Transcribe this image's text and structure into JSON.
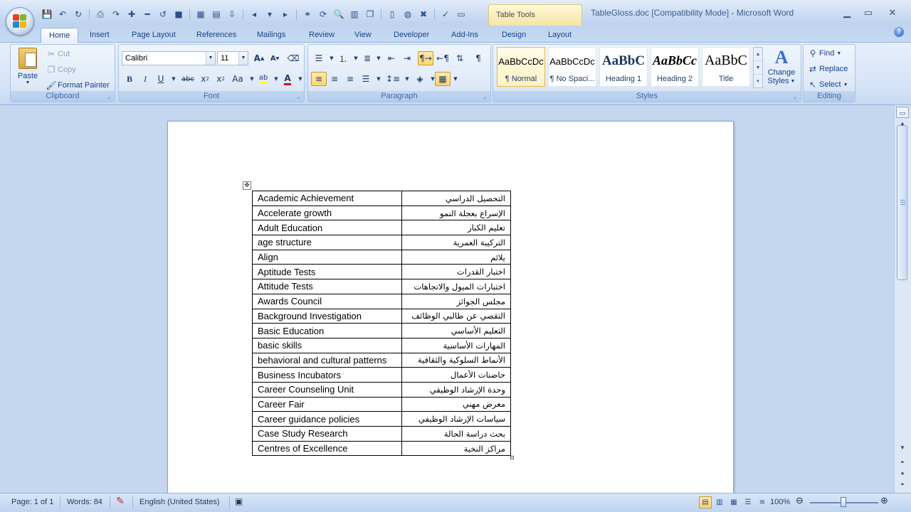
{
  "window": {
    "title": "TableGloss.doc [Compatibility Mode] - Microsoft Word",
    "contextual_tab_group": "Table Tools"
  },
  "tabs": [
    {
      "label": "Home",
      "active": true
    },
    {
      "label": "Insert"
    },
    {
      "label": "Page Layout"
    },
    {
      "label": "References"
    },
    {
      "label": "Mailings"
    },
    {
      "label": "Review"
    },
    {
      "label": "View"
    },
    {
      "label": "Developer"
    },
    {
      "label": "Add-Ins"
    },
    {
      "label": "Design"
    },
    {
      "label": "Layout"
    }
  ],
  "ribbon": {
    "clipboard": {
      "label": "Clipboard",
      "paste": "Paste",
      "cut": "Cut",
      "copy": "Copy",
      "format_painter": "Format Painter"
    },
    "font": {
      "label": "Font",
      "font_name": "Calibri",
      "font_size": "11"
    },
    "paragraph": {
      "label": "Paragraph"
    },
    "styles": {
      "label": "Styles",
      "items": [
        {
          "sample": "AaBbCcDc",
          "name": "¶ Normal",
          "selected": true
        },
        {
          "sample": "AaBbCcDc",
          "name": "¶ No Spaci..."
        },
        {
          "sample": "AaBbC",
          "name": "Heading 1"
        },
        {
          "sample": "AaBbCc",
          "name": "Heading 2"
        },
        {
          "sample": "AaBbC",
          "name": "Title"
        }
      ],
      "change_styles_line1": "Change",
      "change_styles_line2": "Styles"
    },
    "editing": {
      "label": "Editing",
      "find": "Find",
      "replace": "Replace",
      "select": "Select"
    }
  },
  "glossary": [
    {
      "en": "Academic Achievement",
      "ar": "التحصيل الدراسي"
    },
    {
      "en": "Accelerate growth",
      "ar": "الإسراع بعجلة النمو"
    },
    {
      "en": "Adult Education",
      "ar": "تعليم الكبار"
    },
    {
      "en": "age structure",
      "ar": "التركيبة العمرية"
    },
    {
      "en": "Align",
      "ar": "يلائم"
    },
    {
      "en": "Aptitude Tests",
      "ar": "اختبار القدرات"
    },
    {
      "en": "Attitude Tests",
      "ar": "اختبارات الميول والاتجاهات"
    },
    {
      "en": "Awards Council",
      "ar": "مجلس الجوائز"
    },
    {
      "en": "Background Investigation",
      "ar": "التقصي عن طالبي الوظائف"
    },
    {
      "en": "Basic Education",
      "ar": "التعليم الأساسي"
    },
    {
      "en": "basic skills",
      "ar": "المهارات الأساسية"
    },
    {
      "en": "behavioral and cultural patterns",
      "ar": "الأنماط السلوكية والثقافية"
    },
    {
      "en": "Business Incubators",
      "ar": "حاضنات الأعمال"
    },
    {
      "en": "Career Counseling Unit",
      "ar": "وحدة الإرشاد الوظيفي"
    },
    {
      "en": "Career Fair",
      "ar": "معرض مهني"
    },
    {
      "en": "Career guidance policies",
      "ar": "سياسات الإرشاد الوظيفي"
    },
    {
      "en": "Case Study Research",
      "ar": "بحث دراسة الحالة"
    },
    {
      "en": "Centres of Excellence",
      "ar": "مراكز النخبة"
    }
  ],
  "statusbar": {
    "page": "Page: 1 of 1",
    "words": "Words: 84",
    "language": "English (United States)",
    "zoom": "100%"
  }
}
